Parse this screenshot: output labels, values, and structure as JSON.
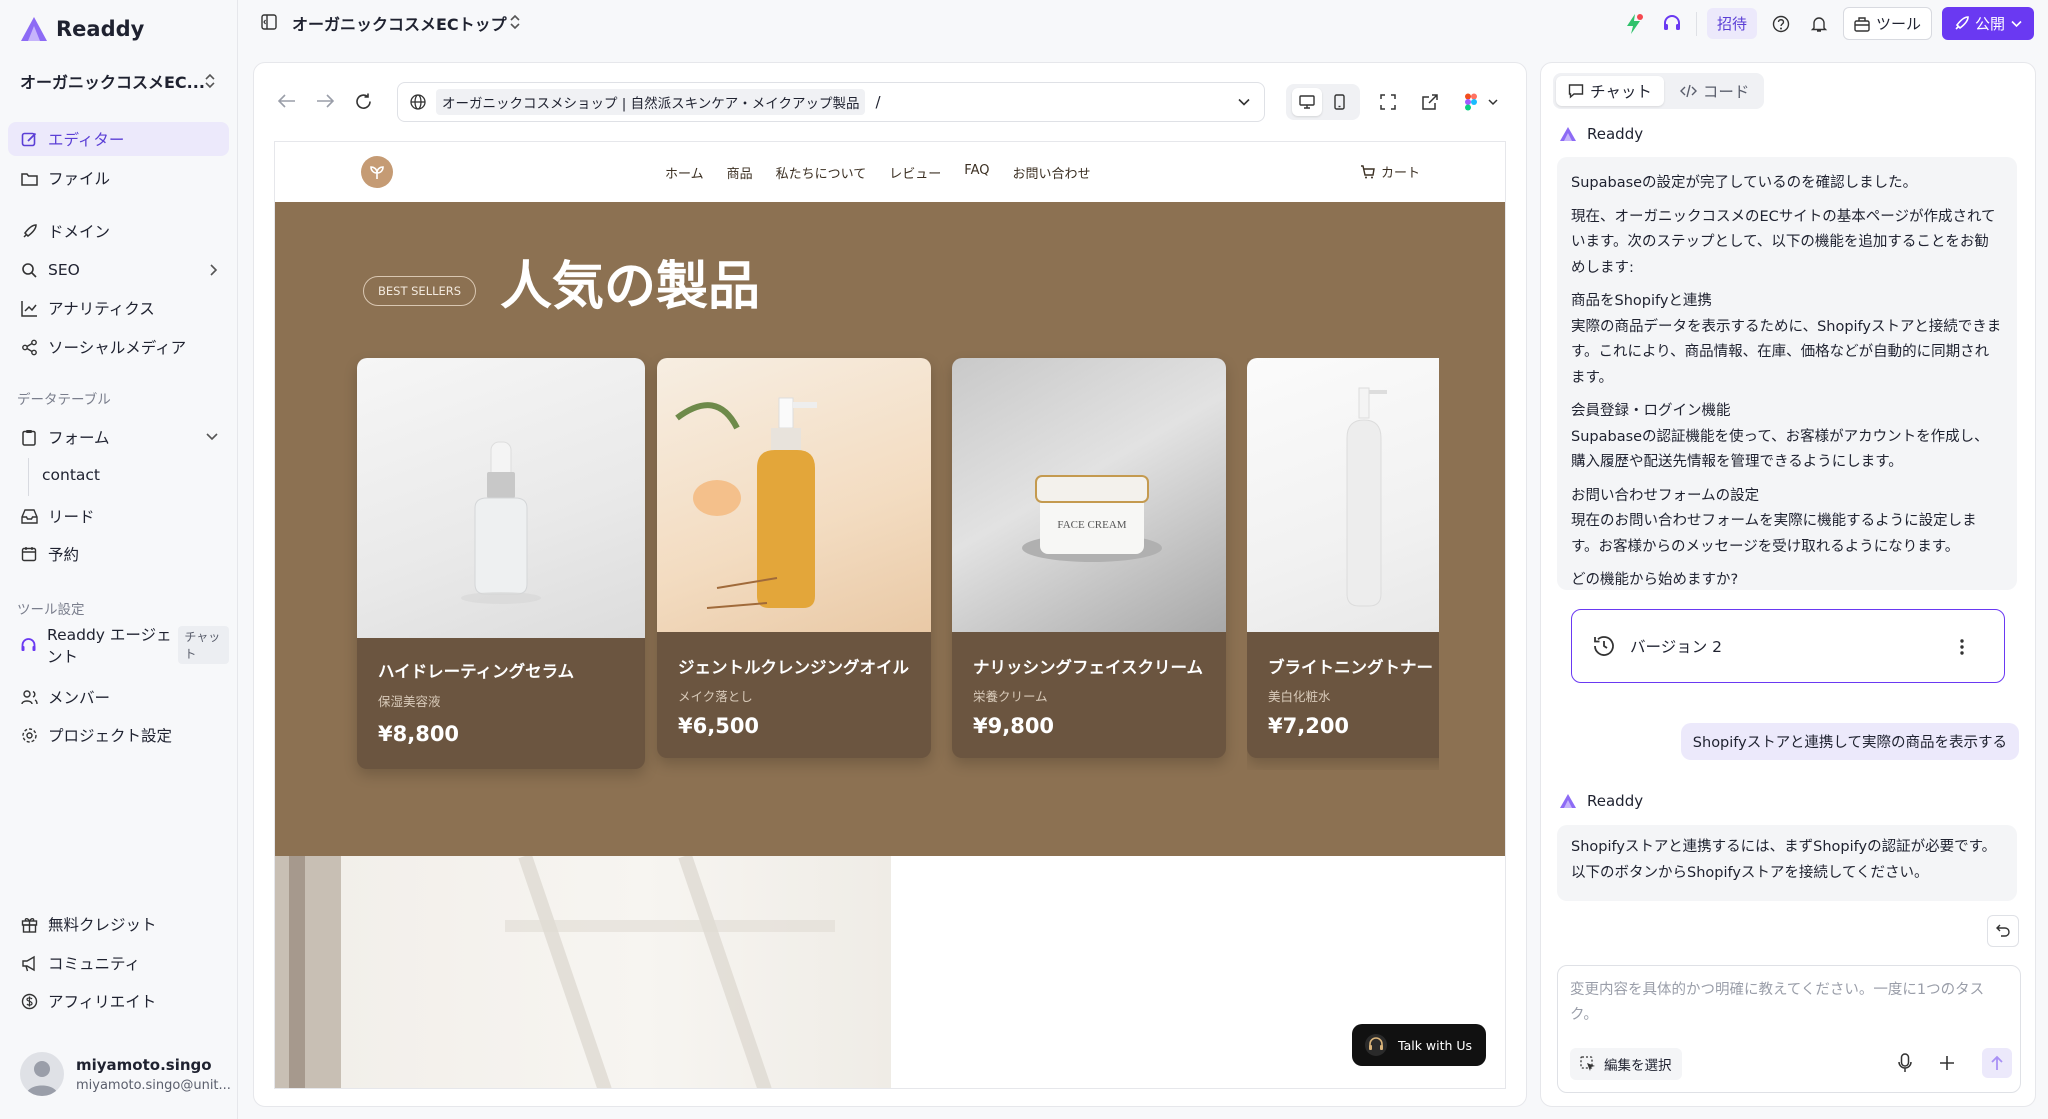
{
  "app": {
    "name": "Readdy",
    "accent": "#6a39f2"
  },
  "sidebar": {
    "project": "オーガニックコスメEC...",
    "items": [
      {
        "label": "エディター",
        "icon": "edit-icon"
      },
      {
        "label": "ファイル",
        "icon": "folder-icon"
      },
      {
        "label": "ドメイン",
        "icon": "rocket-icon"
      },
      {
        "label": "SEO",
        "icon": "search-icon"
      },
      {
        "label": "アナリティクス",
        "icon": "chart-icon"
      },
      {
        "label": "ソーシャルメディア",
        "icon": "share-icon"
      }
    ],
    "data_table_label": "データテーブル",
    "form_label": "フォーム",
    "form_sub": "contact",
    "lead_label": "リード",
    "booking_label": "予約",
    "tool_settings_label": "ツール設定",
    "agent_label": "Readdy エージェント",
    "agent_badge": "チャット",
    "members_label": "メンバー",
    "project_settings_label": "プロジェクト設定",
    "credits_label": "無料クレジット",
    "community_label": "コミュニティ",
    "affiliate_label": "アフィリエイト",
    "user": {
      "name": "miyamoto.singo",
      "email": "miyamoto.singo@unit..."
    }
  },
  "topbar": {
    "title": "オーガニックコスメECトップ",
    "invite": "招待",
    "tools": "ツール",
    "publish": "公開"
  },
  "browser": {
    "url_title": "オーガニックコスメショップ | 自然派スキンケア・メイクアップ製品",
    "url_path": "/"
  },
  "site": {
    "menu": [
      "ホーム",
      "商品",
      "私たちについて",
      "レビュー",
      "FAQ",
      "お問い合わせ"
    ],
    "cart": "カート",
    "badge": "BEST SELLERS",
    "hero_title": "人気の製品",
    "products": [
      {
        "name": "ハイドレーティングセラム",
        "sub": "保湿美容液",
        "price": "¥8,800"
      },
      {
        "name": "ジェントルクレンジングオイル",
        "sub": "メイク落とし",
        "price": "¥6,500"
      },
      {
        "name": "ナリッシングフェイスクリーム",
        "sub": "栄養クリーム",
        "price": "¥9,800"
      },
      {
        "name": "ブライトニングトナー",
        "sub": "美白化粧水",
        "price": "¥7,200"
      }
    ],
    "cream_jar_text": "FACE CREAM",
    "talk_button": "Talk with Us"
  },
  "chat": {
    "tab_chat": "チャット",
    "tab_code": "コード",
    "bot_name": "Readdy",
    "msg1": {
      "p1": "Supabaseの設定が完了しているのを確認しました。",
      "p2": "現在、オーガニックコスメのECサイトの基本ページが作成されています。次のステップとして、以下の機能を追加することをお勧めします:",
      "h1": "商品をShopifyと連携",
      "b1": "実際の商品データを表示するために、Shopifyストアと接続できます。これにより、商品情報、在庫、価格などが自動的に同期されます。",
      "h2": "会員登録・ログイン機能",
      "b2": "Supabaseの認証機能を使って、お客様がアカウントを作成し、購入履歴や配送先情報を管理できるようにします。",
      "h3": "お問い合わせフォームの設定",
      "b3": "現在のお問い合わせフォームを実際に機能するように設定します。お客様からのメッセージを受け取れるようになります。",
      "q": "どの機能から始めますか?"
    },
    "version": "バージョン 2",
    "user_msg": "Shopifyストアと連携して実際の商品を表示する",
    "msg2": "Shopifyストアと連携するには、まずShopifyの認証が必要です。以下のボタンからShopifyストアを接続してください。",
    "input_placeholder": "変更内容を具体的かつ明確に教えてください。一度に1つのタスク。",
    "select_edit": "編集を選択"
  }
}
